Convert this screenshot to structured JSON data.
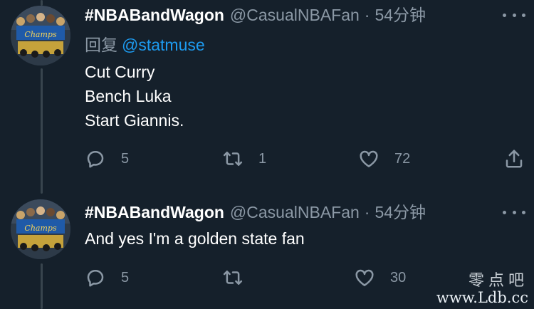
{
  "tweets": [
    {
      "display_name": "#NBABandWagon",
      "handle": "@CasualNBAFan",
      "separator": "·",
      "time": "54分钟",
      "reply_prefix": "回复",
      "reply_to": "@statmuse",
      "lines": [
        "Cut Curry",
        "Bench Luka",
        "Start Giannis."
      ],
      "actions": {
        "reply_count": "5",
        "retweet_count": "1",
        "like_count": "72"
      }
    },
    {
      "display_name": "#NBABandWagon",
      "handle": "@CasualNBAFan",
      "separator": "·",
      "time": "54分钟",
      "lines": [
        "And yes I'm a golden state fan"
      ],
      "actions": {
        "reply_count": "5",
        "retweet_count": "",
        "like_count": "30"
      }
    }
  ],
  "watermark": {
    "chinese": "零点吧",
    "url": "www.Ldb.cc"
  },
  "colors": {
    "background": "#15202b",
    "secondary_text": "#8b98a5",
    "link": "#1d9bf0",
    "thread_line": "#38444d"
  },
  "icons": [
    "reply-icon",
    "retweet-icon",
    "like-icon",
    "share-icon",
    "more-icon"
  ]
}
